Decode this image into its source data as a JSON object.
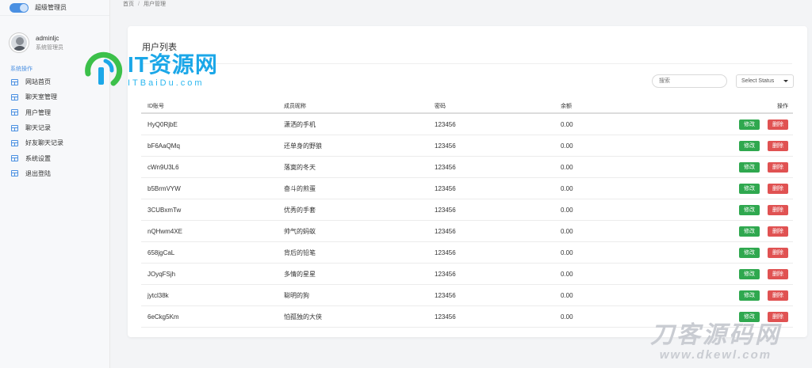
{
  "sidebar": {
    "brand": "超级管理员",
    "user": {
      "name": "adminljc",
      "role": "系统管理员"
    },
    "section": "系统操作",
    "items": [
      {
        "label": "网站首页"
      },
      {
        "label": "聊天室管理"
      },
      {
        "label": "用户管理"
      },
      {
        "label": "聊天记录"
      },
      {
        "label": "好友聊天记录"
      },
      {
        "label": "系统设置"
      },
      {
        "label": "退出登陆"
      }
    ]
  },
  "breadcrumb": {
    "home": "首页",
    "sep": "/",
    "current": "用户管理"
  },
  "card": {
    "title": "用户列表",
    "search_placeholder": "搜索",
    "status_select": "Select Status"
  },
  "table": {
    "headers": [
      "ID账号",
      "成员昵称",
      "密码",
      "余额",
      "操作"
    ],
    "edit_label": "修改",
    "delete_label": "删除",
    "rows": [
      [
        "HyQ0RjbE",
        "潇洒的手机",
        "123456",
        "0.00"
      ],
      [
        "bF6AaQMq",
        "还单身的野狼",
        "123456",
        "0.00"
      ],
      [
        "cWn9U3L6",
        "落寞的冬天",
        "123456",
        "0.00"
      ],
      [
        "b5BrmVYW",
        "奋斗的煎蛋",
        "123456",
        "0.00"
      ],
      [
        "3CUBxmTw",
        "优秀的手套",
        "123456",
        "0.00"
      ],
      [
        "nQHwm4XE",
        "帅气的蚂蚁",
        "123456",
        "0.00"
      ],
      [
        "658jgCaL",
        "背后的铅笔",
        "123456",
        "0.00"
      ],
      [
        "JOyqFSjh",
        "多情的星星",
        "123456",
        "0.00"
      ],
      [
        "jytcl38k",
        "聪明的狗",
        "123456",
        "0.00"
      ],
      [
        "6eCkg5Km",
        "怕孤独的大侠",
        "123456",
        "0.00"
      ]
    ]
  },
  "watermark": {
    "it_title": "IT资源网",
    "it_domain": "ITBaiDu.com",
    "dk_title": "刀客源码网",
    "dk_domain": "www.dkewl.com",
    "colors": {
      "it": "#1ba7e8",
      "it_green": "#3cc04a",
      "dk": "#c9ccd2"
    }
  },
  "colors": {
    "accent": "#4a90e2",
    "edit": "#2fa84f",
    "delete": "#e05252"
  }
}
